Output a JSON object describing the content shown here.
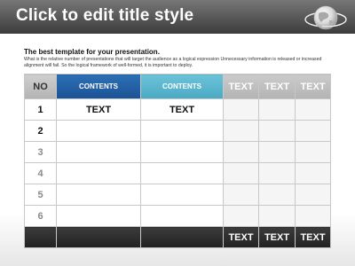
{
  "slide": {
    "title": "Click to edit title style",
    "subtitle": "The best template for your presentation.",
    "description": "What is the relative number of presentations that will target the audience as a logical expression Unnecessary information is released or increased alignment will fail. So the logical framework of well-formed, it is important to deploy."
  },
  "table": {
    "headers": [
      "NO",
      "CONTENTS",
      "CONTENTS",
      "TEXT",
      "TEXT",
      "TEXT"
    ],
    "rows": [
      {
        "no": "1",
        "cells": [
          "TEXT",
          "TEXT",
          "",
          "",
          ""
        ]
      },
      {
        "no": "2",
        "cells": [
          "",
          "",
          "",
          "",
          ""
        ]
      },
      {
        "no": "3",
        "cells": [
          "",
          "",
          "",
          "",
          ""
        ]
      },
      {
        "no": "4",
        "cells": [
          "",
          "",
          "",
          "",
          ""
        ]
      },
      {
        "no": "5",
        "cells": [
          "",
          "",
          "",
          "",
          ""
        ]
      },
      {
        "no": "6",
        "cells": [
          "",
          "",
          "",
          "",
          ""
        ]
      }
    ],
    "footer": [
      "",
      "",
      "",
      "TEXT",
      "TEXT",
      "TEXT"
    ]
  },
  "colors": {
    "header_band": "#4a4a4a",
    "contents_blue": "#1f5fa6",
    "contents_teal": "#57b4cc",
    "footer_band": "#2b2b2b"
  },
  "icons": [
    "globe-icon"
  ]
}
